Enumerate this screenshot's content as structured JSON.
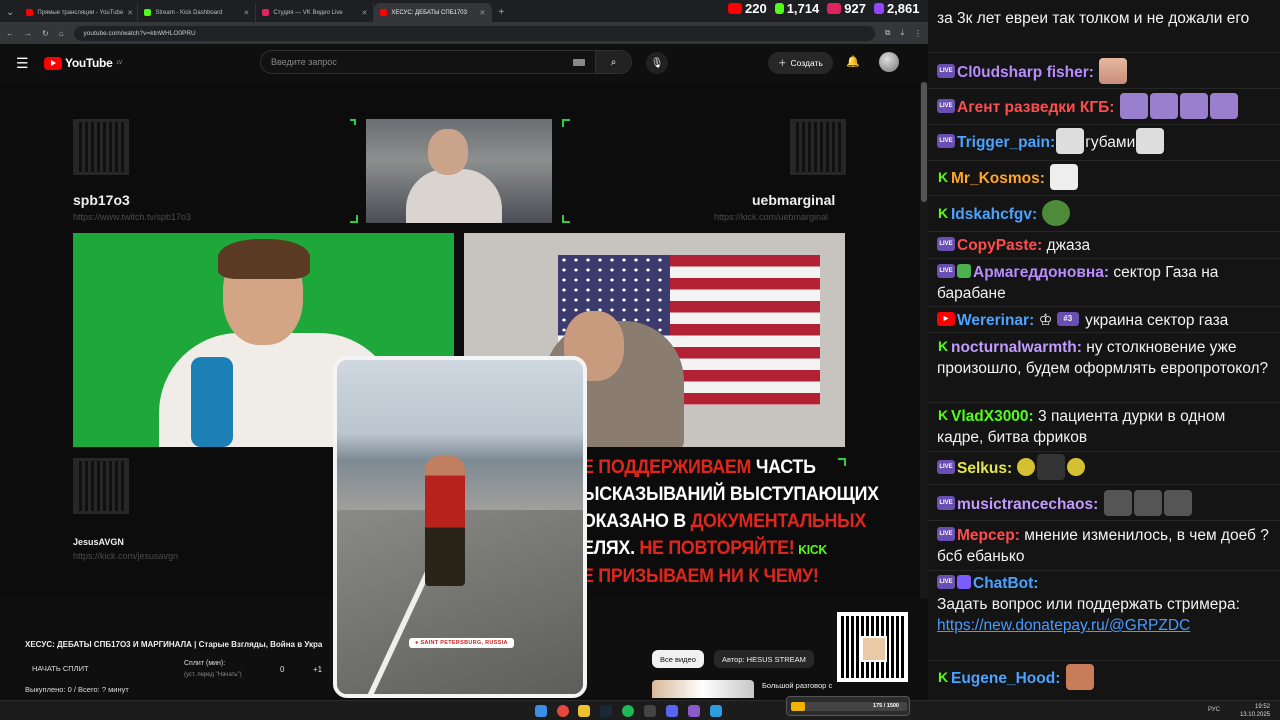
{
  "browser": {
    "tabs": [
      {
        "label": "Прямые трансляции - YouTube",
        "color": "#ff0000",
        "active": false
      },
      {
        "label": "Stream - Kick Dashboard",
        "color": "#53fc18",
        "active": false
      },
      {
        "label": "Студия — VK Видео Live",
        "color": "#e0245e",
        "active": false
      },
      {
        "label": "ХЕСУС: ДЕБАТЫ СПБ1703",
        "color": "#ff0000",
        "active": true
      }
    ],
    "url": "youtube.com/watch?v=ktnWHLO0PRU"
  },
  "top_counts": [
    {
      "platform": "youtube",
      "value": "220",
      "color": "#ff0000"
    },
    {
      "platform": "kick",
      "value": "1,714",
      "color": "#53fc18"
    },
    {
      "platform": "vk",
      "value": "927",
      "color": "#e0245e"
    },
    {
      "platform": "twitch",
      "value": "2,861",
      "color": "#9146ff"
    }
  ],
  "youtube": {
    "logo": "YouTube",
    "region": "LV",
    "search_placeholder": "Введите запрос",
    "create_label": "Создать"
  },
  "player": {
    "left_name": "spb17o3",
    "left_link": "https://www.twitch.tv/spb17o3",
    "right_name": "uebmarginal",
    "right_link": "https://kick.com/uebmarginal",
    "bottom_name": "JesusAVGN",
    "bottom_link": "https://kick.com/jesusavgn",
    "banner_lines": [
      [
        {
          "t": "Е ПОДДЕРЖИВАЕМ ",
          "red": true
        },
        {
          "t": "ЧАСТЬ",
          "red": false
        }
      ],
      [
        {
          "t": "ЫСКАЗЫВАНИЙ ВЫСТУПАЮЩИХ",
          "red": false
        }
      ],
      [
        {
          "t": "ОКАЗАНО В ",
          "red": false
        },
        {
          "t": "ДОКУМЕНТАЛЬНЫХ",
          "red": true
        }
      ],
      [
        {
          "t": "ЕЛЯХ. ",
          "red": false
        },
        {
          "t": "НЕ ПОВТОРЯЙТЕ!",
          "red": true
        }
      ],
      [
        {
          "t": "Е ПРИЗЫВАЕМ НИ К ЧЕМУ!",
          "red": true
        }
      ]
    ],
    "kick_tag": "KICK",
    "phone_location": "SAINT PETERSBURG, RUSSIA"
  },
  "below": {
    "title": "ХЕСУС: ДЕБАТЫ СПБ17О3 И МАРГИНАЛА | Старые Взгляды, Война в Укра",
    "split_button": "НАЧАТЬ СПЛИТ",
    "split_label": "Сплит (мин):",
    "split_hint": "(уст. перед \"Начать\")",
    "split_value": "0",
    "split_plus": "+1",
    "paid": "Выкуплено: 0 / Всего: ? минут",
    "chips": [
      "Все видео",
      "Автор: HESUS STREAM"
    ],
    "rec_title": "Большой разговор с"
  },
  "chat": {
    "messages": [
      {
        "badge": "none",
        "nick": "",
        "nick_color": "#ffffff",
        "text": "за 3к лет евреи так толком и не дожали его"
      },
      {
        "badge": "live",
        "nick": "Cl0udsharp fisher:",
        "nick_color": "#b88cff",
        "text": ""
      },
      {
        "badge": "live",
        "nick": "Агент разведки КГБ:",
        "nick_color": "#ff4d4d",
        "text": ""
      },
      {
        "badge": "live",
        "nick": "Trigger_pain:",
        "nick_color": "#4aa3ff",
        "text": "губами"
      },
      {
        "badge": "kick",
        "nick": "Mr_Kosmos:",
        "nick_color": "#ffa623",
        "text": ""
      },
      {
        "badge": "kick",
        "nick": "Idskahcfgv:",
        "nick_color": "#4aa3ff",
        "text": ""
      },
      {
        "badge": "live",
        "nick": "CopyPaste:",
        "nick_color": "#ff4d4d",
        "text": "джаза"
      },
      {
        "badge": "live",
        "nick": "Армагеддоновна:",
        "nick_color": "#b88cff",
        "text": "сектор Газа на барабане"
      },
      {
        "badge": "yt",
        "nick": "Wererinar:",
        "nick_color": "#4aa3ff",
        "text": "украина сектор газа",
        "rank": "#3"
      },
      {
        "badge": "kick",
        "nick": "nocturnalwarmth:",
        "nick_color": "#c39bff",
        "text": "ну столкновение уже произошло, будем оформлять европротокол?"
      },
      {
        "badge": "kick",
        "nick": "VladX3000:",
        "nick_color": "#53fc18",
        "text": "3 пациента дурки в одном кадре, битва фриков"
      },
      {
        "badge": "live",
        "nick": "Selkus:",
        "nick_color": "#e6e64a",
        "text": ""
      },
      {
        "badge": "live",
        "nick": "musictrancechaos:",
        "nick_color": "#c39bff",
        "text": ""
      },
      {
        "badge": "live",
        "nick": "Мерсер:",
        "nick_color": "#ff4d4d",
        "text": "мнение изменилось, в чем доеб ? бсб ебанько"
      },
      {
        "badge": "live",
        "nick": "ChatBot:",
        "nick_color": "#4aa3ff",
        "text": "Задать вопрос или поддержать стримера:"
      },
      {
        "badge": "kick",
        "nick": "Eugene_Hood:",
        "nick_color": "#4aa3ff",
        "text": ""
      }
    ],
    "bot_link": "https://new.donatepay.ru/@GRPZDC"
  },
  "donation": {
    "text": "175 / 1500",
    "progress": 0.117
  },
  "clock": {
    "time": "19:52",
    "date": "13.10.2025",
    "lang": "РУС"
  }
}
